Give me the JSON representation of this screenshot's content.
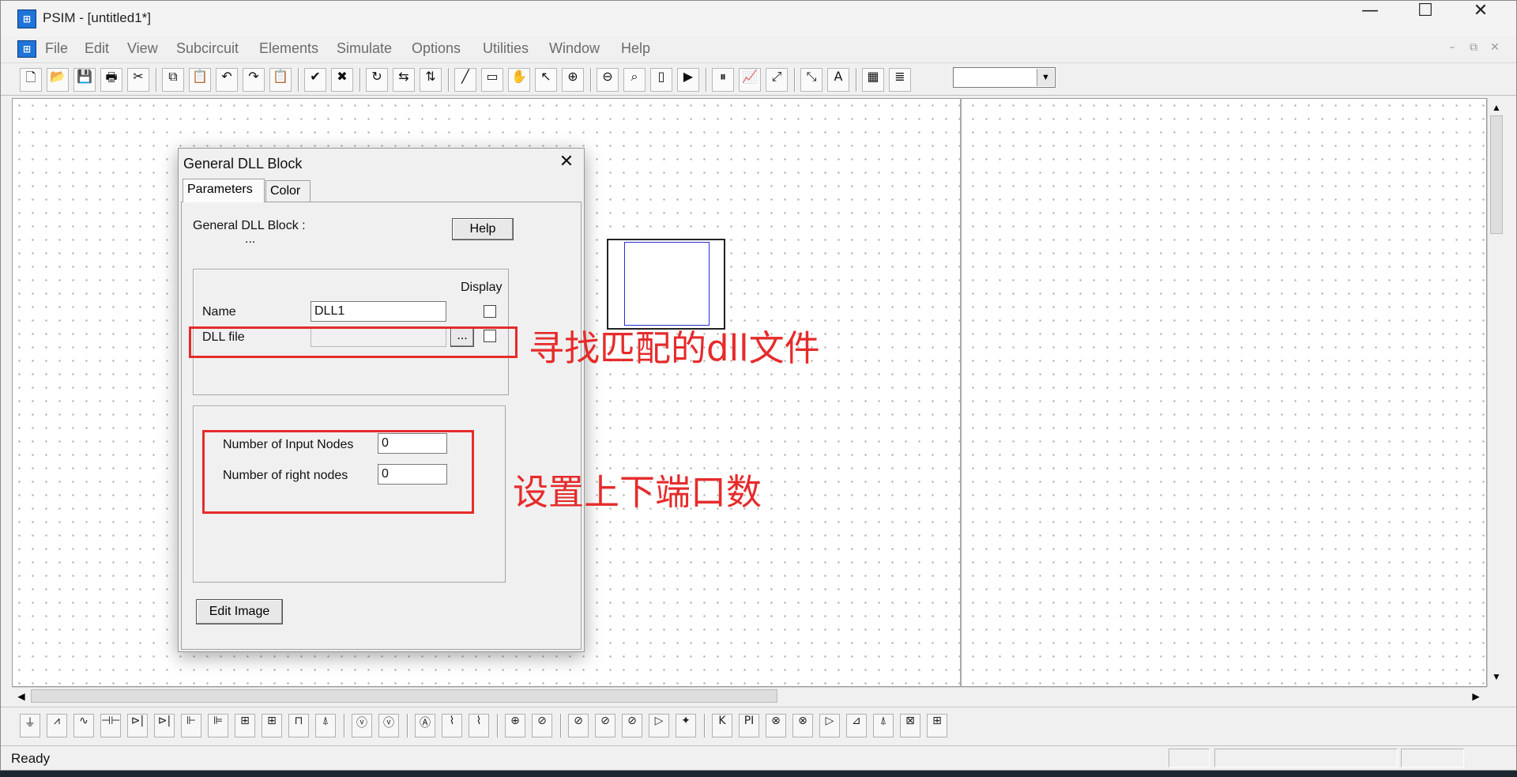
{
  "window": {
    "title": "PSIM - [untitled1*]",
    "app_icon_glyph": "⊞",
    "controls": {
      "minimize": "—",
      "maximize": "☐",
      "close": "✕"
    }
  },
  "menu": {
    "items": [
      "File",
      "Edit",
      "View",
      "Subcircuit",
      "Elements",
      "Simulate",
      "Options",
      "Utilities",
      "Window",
      "Help"
    ],
    "mdi_controls": [
      "–",
      "⧉",
      "✕"
    ]
  },
  "toolbar": {
    "buttons": [
      {
        "name": "new-file-icon",
        "glyph": "🗋"
      },
      {
        "name": "open-folder-icon",
        "glyph": "📂"
      },
      {
        "name": "save-icon",
        "glyph": "💾"
      },
      {
        "name": "print-icon",
        "glyph": "🖶"
      },
      {
        "name": "cut-icon",
        "glyph": "✂"
      },
      {
        "name": "copy-icon",
        "glyph": "⧉"
      },
      {
        "name": "paste-icon",
        "glyph": "📋"
      },
      {
        "name": "undo-icon",
        "glyph": "↶"
      },
      {
        "name": "redo-icon",
        "glyph": "↷"
      },
      {
        "name": "clipboard-icon",
        "glyph": "📋"
      },
      {
        "name": "check-icon",
        "glyph": "✔"
      },
      {
        "name": "cross-icon",
        "glyph": "✖"
      },
      {
        "name": "rotate-icon",
        "glyph": "↻"
      },
      {
        "name": "flip-horizontal-icon",
        "glyph": "⇆"
      },
      {
        "name": "flip-vertical-icon",
        "glyph": "⇅"
      },
      {
        "name": "wire-icon",
        "glyph": "╱"
      },
      {
        "name": "label-icon",
        "glyph": "▭"
      },
      {
        "name": "pan-hand-icon",
        "glyph": "✋"
      },
      {
        "name": "select-arrow-icon",
        "glyph": "↖"
      },
      {
        "name": "zoom-in-icon",
        "glyph": "⊕"
      },
      {
        "name": "zoom-out-icon",
        "glyph": "⊖"
      },
      {
        "name": "zoom-region-icon",
        "glyph": "⌕"
      },
      {
        "name": "fit-page-icon",
        "glyph": "▯"
      },
      {
        "name": "run-simulation-icon",
        "glyph": "▶"
      },
      {
        "name": "pause-icon",
        "glyph": "⏸"
      },
      {
        "name": "simview-icon",
        "glyph": "📈"
      },
      {
        "name": "voltage-probe-icon",
        "glyph": "⤢"
      },
      {
        "name": "current-probe-icon",
        "glyph": "⤡"
      },
      {
        "name": "text-icon",
        "glyph": "A"
      },
      {
        "name": "element-list-icon",
        "glyph": "▦"
      },
      {
        "name": "netlist-icon",
        "glyph": "≣"
      }
    ],
    "dropdown_value": ""
  },
  "palette": {
    "buttons": [
      {
        "name": "ground-icon",
        "glyph": "⏚"
      },
      {
        "name": "resistor-icon",
        "glyph": "⩘"
      },
      {
        "name": "inductor-icon",
        "glyph": "∿"
      },
      {
        "name": "capacitor-icon",
        "glyph": "⊣⊢"
      },
      {
        "name": "diode-icon",
        "glyph": "⊳|"
      },
      {
        "name": "thyristor-icon",
        "glyph": "⊳|"
      },
      {
        "name": "igbt-icon",
        "glyph": "⊩"
      },
      {
        "name": "mosfet-icon",
        "glyph": "⊫"
      },
      {
        "name": "switch-module-icon",
        "glyph": "⊞"
      },
      {
        "name": "switch-module-2-icon",
        "glyph": "⊞"
      },
      {
        "name": "transformer-icon",
        "glyph": "⊓"
      },
      {
        "name": "motor-icon",
        "glyph": "⍋"
      },
      {
        "name": "voltage-source-icon",
        "glyph": "ⓥ"
      },
      {
        "name": "ac-voltage-icon",
        "glyph": "ⓥ"
      },
      {
        "name": "ammeter-icon",
        "glyph": "Ⓐ"
      },
      {
        "name": "scope-icon",
        "glyph": "⌇"
      },
      {
        "name": "scope-2-icon",
        "glyph": "⌇"
      },
      {
        "name": "dc-source-icon",
        "glyph": "⊕"
      },
      {
        "name": "ac-source-icon",
        "glyph": "⊘"
      },
      {
        "name": "square-source-icon",
        "glyph": "⊘"
      },
      {
        "name": "current-source-icon",
        "glyph": "⊘"
      },
      {
        "name": "triangle-source-icon",
        "glyph": "⊘"
      },
      {
        "name": "comparator-icon",
        "glyph": "▷"
      },
      {
        "name": "summer-icon",
        "glyph": "✦"
      },
      {
        "name": "gain-icon",
        "glyph": "K"
      },
      {
        "name": "pi-controller-icon",
        "glyph": "PI"
      },
      {
        "name": "multiplier-icon",
        "glyph": "⊗"
      },
      {
        "name": "divider-icon",
        "glyph": "⊗"
      },
      {
        "name": "op-amp-icon",
        "glyph": "▷"
      },
      {
        "name": "limiter-icon",
        "glyph": "⊿"
      },
      {
        "name": "probe-icon",
        "glyph": "⍋"
      },
      {
        "name": "switch-controller-icon",
        "glyph": "⊠"
      },
      {
        "name": "on-off-controller-icon",
        "glyph": "⊞"
      }
    ]
  },
  "status": {
    "text": "Ready"
  },
  "dialog": {
    "title": "General DLL Block",
    "close_glyph": "✕",
    "tabs": [
      "Parameters",
      "Color"
    ],
    "header_label": "General DLL Block :",
    "header_sub": "...",
    "help_button": "Help",
    "display_label": "Display",
    "fields": {
      "name_label": "Name",
      "name_value": "DLL1",
      "dll_file_label": "DLL file",
      "dll_file_value": "",
      "browse_button": "...",
      "input_nodes_label": "Number of Input Nodes",
      "input_nodes_value": "0",
      "right_nodes_label": "Number of right nodes",
      "right_nodes_value": "0"
    },
    "edit_image_button": "Edit Image"
  },
  "annotations": {
    "dll_note": "寻找匹配的dll文件",
    "ports_note": "设置上下端口数"
  },
  "colors": {
    "annotation": "#e62b2b",
    "symbol_inner": "#2a2ad4",
    "app_icon": "#1f74d8"
  }
}
